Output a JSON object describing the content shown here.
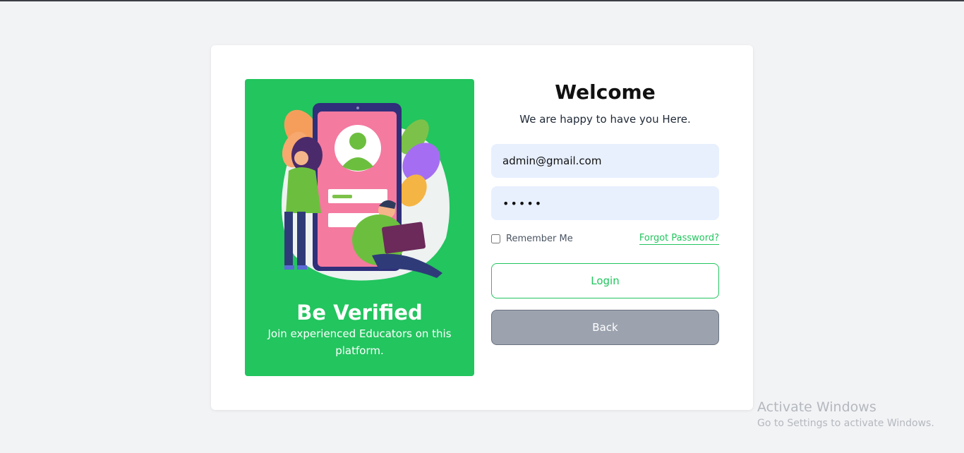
{
  "promo": {
    "title": "Be Verified",
    "subtitle": "Join experienced Educators on this platform."
  },
  "form": {
    "heading": "Welcome",
    "tagline": "We are happy to have you Here.",
    "email_value": "admin@gmail.com",
    "password_value": "•••••",
    "remember_label": "Remember Me",
    "remember_checked": false,
    "forgot_label": "Forgot Password?",
    "login_label": "Login",
    "back_label": "Back"
  },
  "watermark": {
    "title": "Activate Windows",
    "subtitle": "Go to Settings to activate Windows."
  },
  "colors": {
    "accent": "#22c55e",
    "background": "#f2f3f5",
    "input_bg": "#e8f0fe",
    "back_button": "#9ca3af"
  },
  "icons": [
    "user-avatar-illustration",
    "phone-illustration",
    "laptop-illustration"
  ]
}
